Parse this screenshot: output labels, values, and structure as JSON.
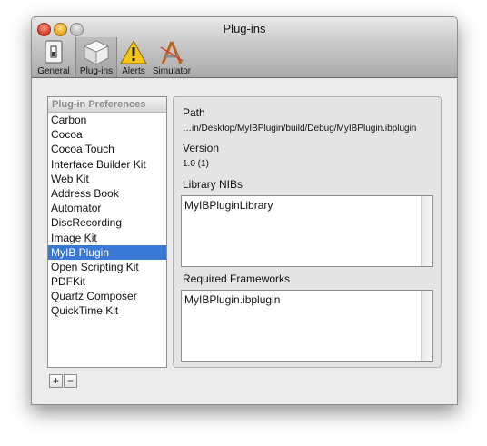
{
  "window": {
    "title": "Plug-ins"
  },
  "toolbar": {
    "items": [
      {
        "label": "General",
        "icon": "switch-icon"
      },
      {
        "label": "Plug-ins",
        "icon": "plugin-cube-icon",
        "selected": true
      },
      {
        "label": "Alerts",
        "icon": "warning-triangle-icon"
      },
      {
        "label": "Simulator",
        "icon": "simulator-app-icon"
      }
    ]
  },
  "sidebar": {
    "header": "Plug-in Preferences",
    "items": [
      "Carbon",
      "Cocoa",
      "Cocoa Touch",
      "Interface Builder Kit",
      "Web Kit",
      "Address Book",
      "Automator",
      "DiscRecording",
      "Image Kit",
      "MyIB Plugin",
      "Open Scripting Kit",
      "PDFKit",
      "Quartz Composer",
      "QuickTime Kit"
    ],
    "selected": "MyIB Plugin",
    "add_label": "+",
    "remove_label": "−"
  },
  "details": {
    "path_label": "Path",
    "path_value": "…in/Desktop/MyIBPlugin/build/Debug/MyIBPlugin.ibplugin",
    "version_label": "Version",
    "version_value": "1.0 (1)",
    "library_label": "Library NIBs",
    "library_value": "MyIBPluginLibrary",
    "frameworks_label": "Required Frameworks",
    "frameworks_value": "MyIBPlugin.ibplugin"
  },
  "colors": {
    "selection": "#3a78d6",
    "window_bg": "#ececec"
  }
}
